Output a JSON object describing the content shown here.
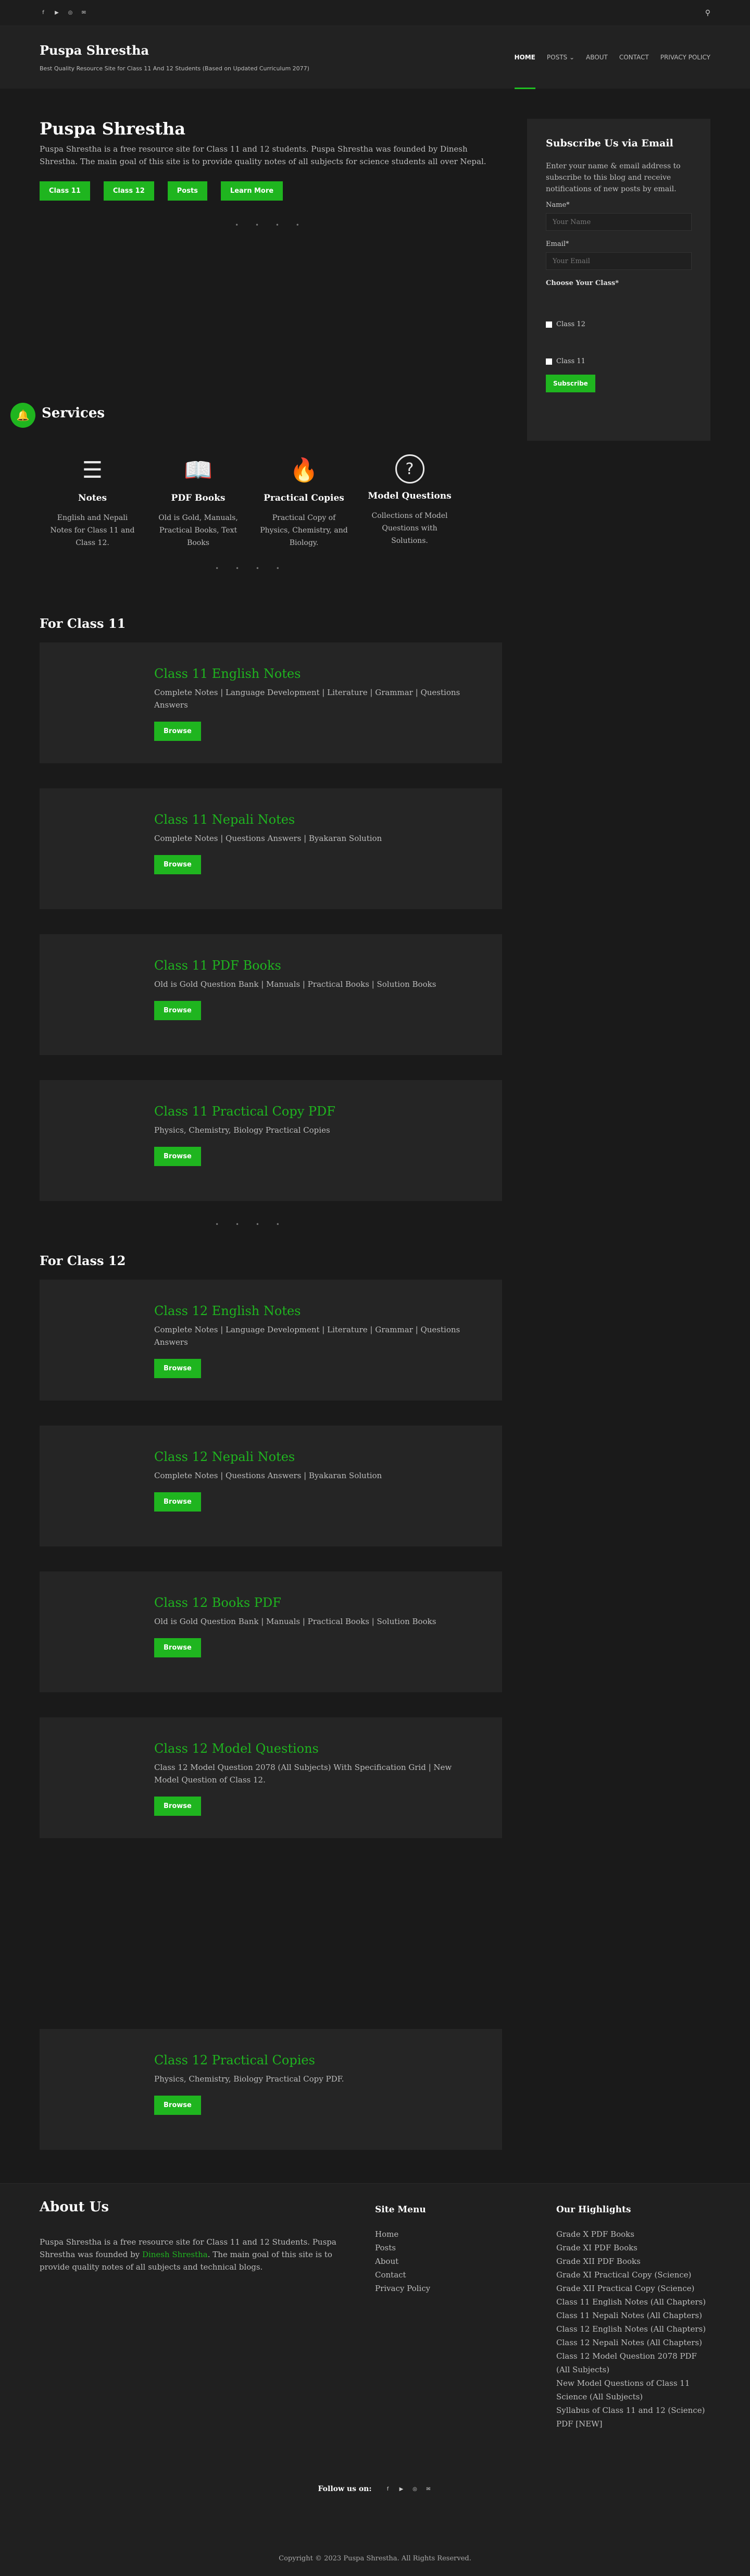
{
  "topbar": {
    "social_icons": [
      "facebook-icon",
      "youtube-icon",
      "instagram-icon",
      "email-icon"
    ],
    "social_glyphs": [
      "f",
      "▶",
      "◎",
      "✉"
    ],
    "search_glyph": "⚲"
  },
  "header": {
    "title": "Puspa Shrestha",
    "tagline": "Best Quality Resource Site for Class 11 And 12 Students (Based on Updated Curriculum 2077)",
    "nav": [
      "Home",
      "Posts ⌄",
      "About",
      "Contact",
      "Privacy Policy"
    ]
  },
  "hero": {
    "title": "Puspa Shrestha",
    "text": "Puspa Shrestha is a free resource site for Class 11 and 12 students. Puspa Shrestha was founded by Dinesh Shrestha. The main goal of this site is to provide quality notes of all subjects for science students all over Nepal.",
    "buttons": [
      "Class 11",
      "Class 12",
      "Posts",
      "Learn More"
    ],
    "dots": "• • • •"
  },
  "subscribe": {
    "title": "Subscribe Us via Email",
    "text": "Enter your name & email address to subscribe to this blog and receive notifications of new posts by email.",
    "name_label": "Name*",
    "name_placeholder": "Your Name",
    "email_label": "Email*",
    "email_placeholder": "Your Email",
    "class_label": "Choose Your Class*",
    "options": [
      "Class 12",
      "Class 11"
    ],
    "button": "Subscribe"
  },
  "services": {
    "title": "Services",
    "bell_glyph": "🔔",
    "items": [
      {
        "icon": "notes-icon",
        "glyph": "☰",
        "title": "Notes",
        "text": "English and Nepali Notes for Class 11 and Class 12."
      },
      {
        "icon": "book-icon",
        "glyph": "📖",
        "title": "PDF Books",
        "text": "Old is Gold, Manuals, Practical Books, Text Books"
      },
      {
        "icon": "flame-icon",
        "glyph": "🔥",
        "title": "Practical Copies",
        "text": "Practical Copy of Physics, Chemistry, and Biology."
      },
      {
        "icon": "question-icon",
        "glyph": "?",
        "title": "Model Questions",
        "text": "Collections of Model Questions with Solutions."
      }
    ]
  },
  "class11": {
    "title": "For Class 11",
    "cards": [
      {
        "title": "Class 11 English Notes",
        "text": "Complete Notes | Language Development | Literature | Grammar | Questions Answers",
        "button": "Browse"
      },
      {
        "title": "Class 11 Nepali Notes",
        "text": "Complete Notes | Questions Answers | Byakaran Solution",
        "button": "Browse"
      },
      {
        "title": "Class 11 PDF Books",
        "text": "Old is Gold Question Bank | Manuals | Practical Books | Solution Books",
        "button": "Browse"
      },
      {
        "title": "Class 11 Practical Copy PDF",
        "text": "Physics, Chemistry, Biology Practical Copies",
        "button": "Browse"
      }
    ]
  },
  "class12": {
    "title": "For Class 12",
    "cards": [
      {
        "title": "Class 12 English Notes",
        "text": "Complete Notes | Language Development | Literature | Grammar | Questions Answers",
        "button": "Browse"
      },
      {
        "title": "Class 12 Nepali Notes",
        "text": "Complete Notes | Questions Answers | Byakaran Solution",
        "button": "Browse"
      },
      {
        "title": "Class 12 Books PDF",
        "text": "Old is Gold Question Bank | Manuals | Practical Books | Solution Books",
        "button": "Browse"
      },
      {
        "title": "Class 12 Model Questions",
        "text": "Class 12 Model Question 2078 (All Subjects) With Specification Grid | New Model Question of Class 12.",
        "button": "Browse"
      },
      {
        "title": "Class 12 Practical Copies",
        "text": "Physics, Chemistry, Biology Practical Copy PDF.",
        "button": "Browse"
      }
    ]
  },
  "footer": {
    "about_title": "About Us",
    "about_text_1": "Puspa Shrestha is a free resource site for Class 11 and 12 Students. Puspa Shrestha was founded by ",
    "about_link": "Dinesh Shrestha",
    "about_text_2": ". The main goal of this site is to provide quality notes of all subjects and technical blogs.",
    "menu_title": "Site Menu",
    "menu": [
      "Home",
      "Posts",
      "About",
      "Contact",
      "Privacy Policy"
    ],
    "highlights_title": "Our Highlights",
    "highlights": [
      "Grade X PDF Books",
      "Grade XI PDF Books",
      "Grade XII PDF Books",
      "Grade XI Practical Copy (Science)",
      "Grade XII Practical Copy (Science)",
      "Class 11 English Notes (All Chapters)",
      "Class 11 Nepali Notes (All Chapters)",
      "Class 12 English Notes (All Chapters)",
      "Class 12 Nepali Notes (All Chapters)",
      "Class 12 Model Question 2078 PDF (All Subjects)",
      "New Model Questions of Class 11 Science (All Subjects)",
      "Syllabus of Class 11 and 12 (Science) PDF [NEW]"
    ],
    "follow_label": "Follow us on:",
    "copyright": "Copyright © 2023 Puspa Shrestha. All Rights Reserved."
  },
  "colors": {
    "accent": "#1fb51f",
    "background": "#1a1a1a",
    "card": "#252525"
  }
}
